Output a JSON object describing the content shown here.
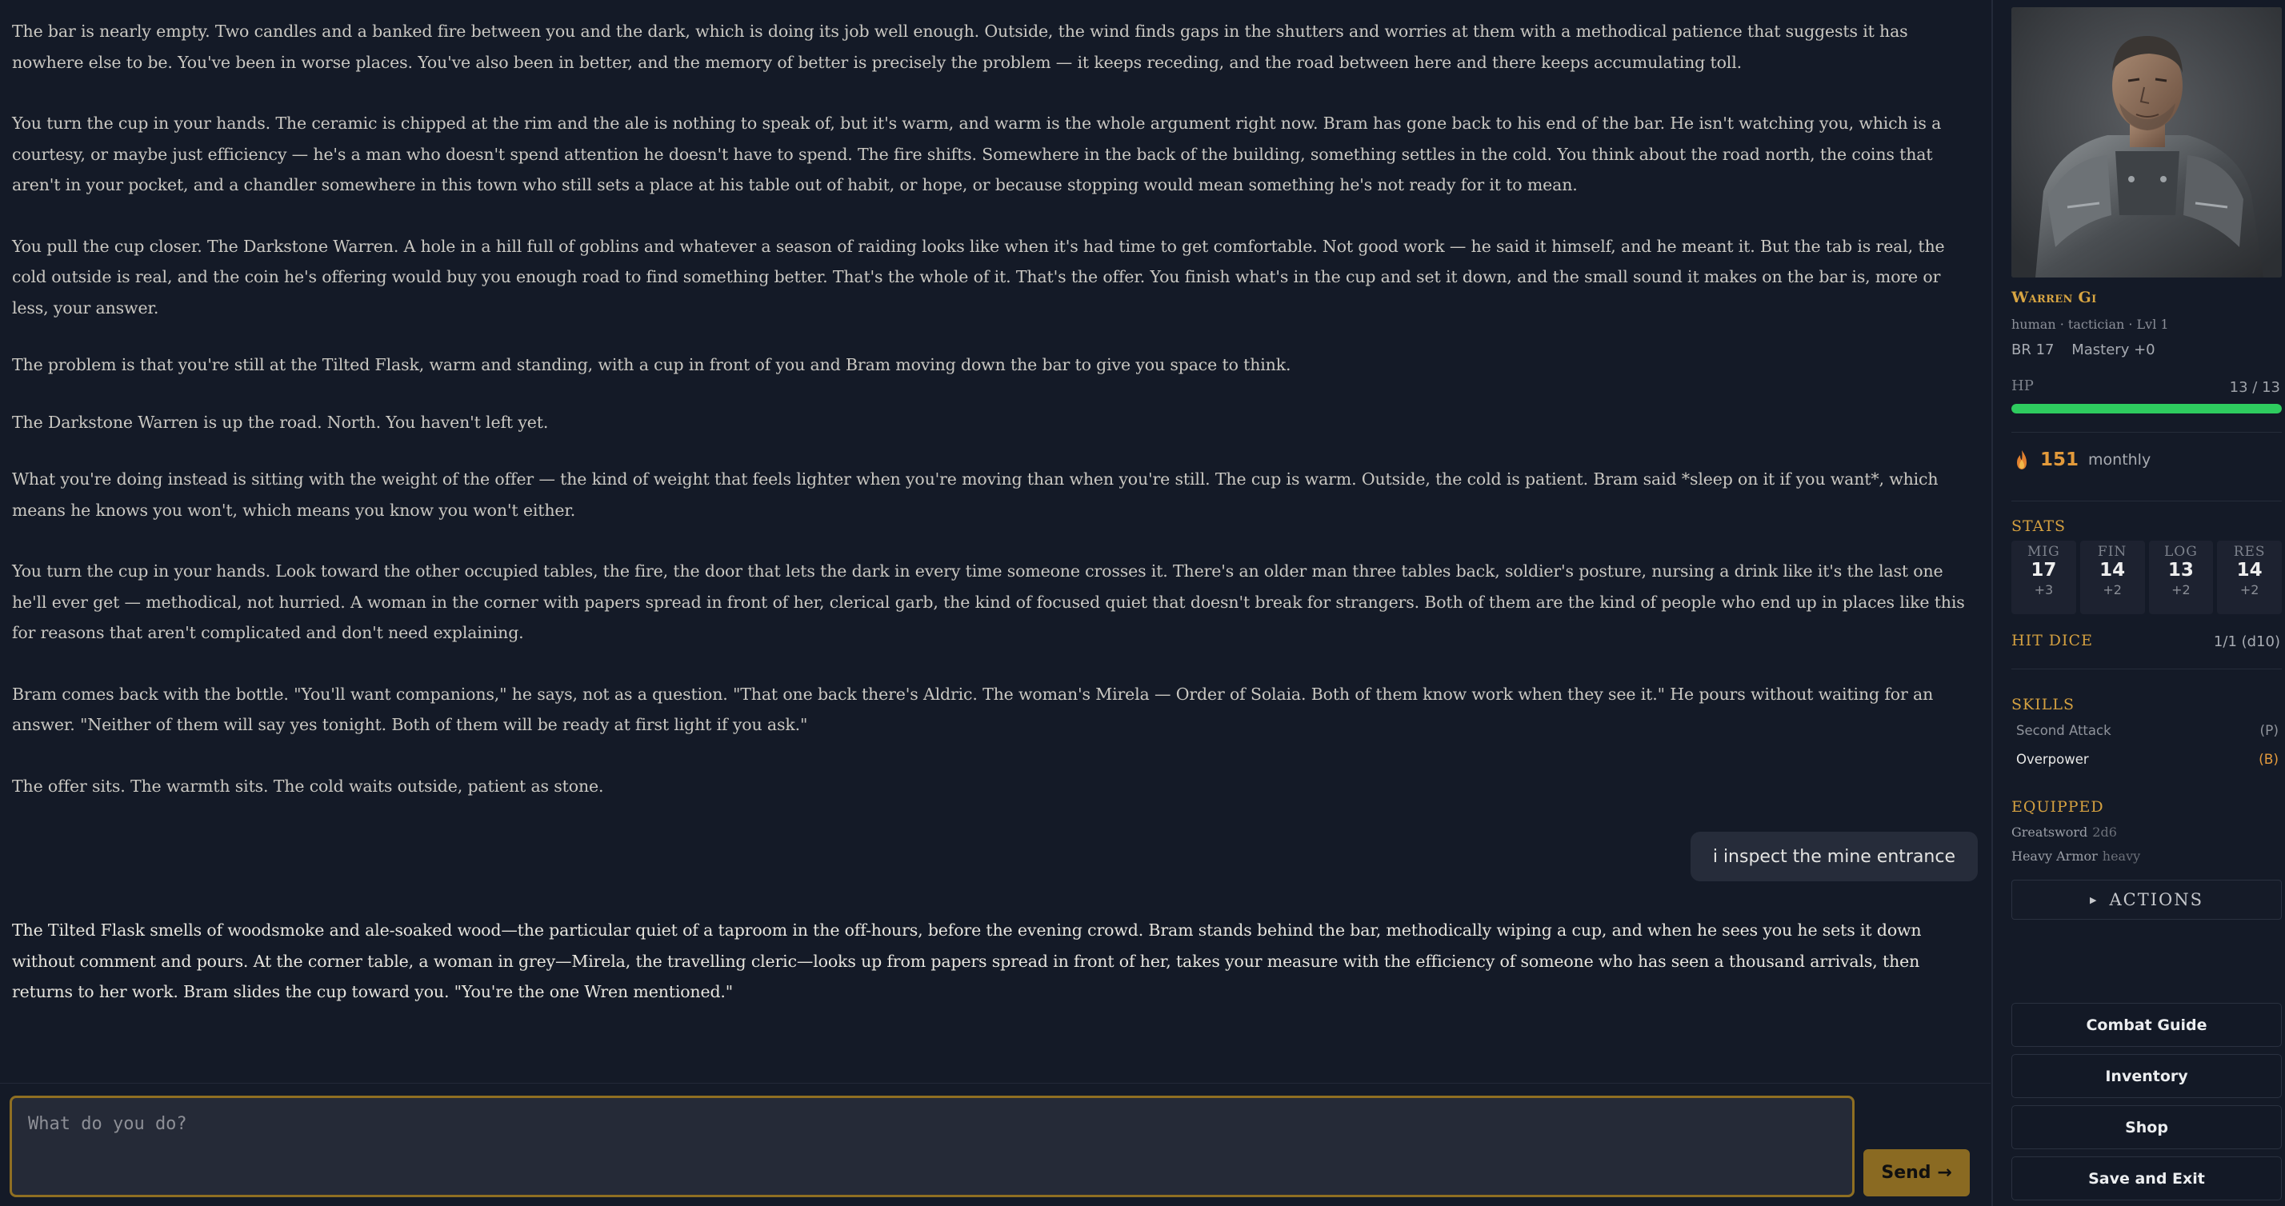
{
  "story": {
    "paragraphs": [
      "The bar is nearly empty. Two candles and a banked fire between you and the dark, which is doing its job well enough. Outside, the wind finds gaps in the shutters and worries at them with a methodical patience that suggests it has nowhere else to be. You've been in worse places. You've also been in better, and the memory of better is precisely the problem — it keeps receding, and the road between here and there keeps accumulating toll.",
      "You turn the cup in your hands. The ceramic is chipped at the rim and the ale is nothing to speak of, but it's warm, and warm is the whole argument right now. Bram has gone back to his end of the bar. He isn't watching you, which is a courtesy, or maybe just efficiency — he's a man who doesn't spend attention he doesn't have to spend. The fire shifts. Somewhere in the back of the building, something settles in the cold. You think about the road north, the coins that aren't in your pocket, and a chandler somewhere in this town who still sets a place at his table out of habit, or hope, or because stopping would mean something he's not ready for it to mean.",
      "You pull the cup closer. The Darkstone Warren. A hole in a hill full of goblins and whatever a season of raiding looks like when it's had time to get comfortable. Not good work — he said it himself, and he meant it. But the tab is real, the cold outside is real, and the coin he's offering would buy you enough road to find something better. That's the whole of it. That's the offer. You finish what's in the cup and set it down, and the small sound it makes on the bar is, more or less, your answer.",
      "The problem is that you're still at the Tilted Flask, warm and standing, with a cup in front of you and Bram moving down the bar to give you space to think.",
      "The Darkstone Warren is up the road. North. You haven't left yet.",
      "What you're doing instead is sitting with the weight of the offer — the kind of weight that feels lighter when you're moving than when you're still. The cup is warm. Outside, the cold is patient. Bram said *sleep on it if you want*, which means he knows you won't, which means you know you won't either.",
      "You turn the cup in your hands. Look toward the other occupied tables, the fire, the door that lets the dark in every time someone crosses it. There's an older man three tables back, soldier's posture, nursing a drink like it's the last one he'll ever get — methodical, not hurried. A woman in the corner with papers spread in front of her, clerical garb, the kind of focused quiet that doesn't break for strangers. Both of them are the kind of people who end up in places like this for reasons that aren't complicated and don't need explaining.",
      "Bram comes back with the bottle. \"You'll want companions,\" he says, not as a question. \"That one back there's Aldric. The woman's Mirela — Order of Solaia. Both of them know work when they see it.\" He pours without waiting for an answer. \"Neither of them will say yes tonight. Both of them will be ready at first light if you ask.\"",
      "The offer sits. The warmth sits. The cold waits outside, patient as stone."
    ],
    "user_message": "i inspect the mine entrance",
    "response": "The Tilted Flask smells of woodsmoke and ale-soaked wood—the particular quiet of a taproom in the off-hours, before the evening crowd. Bram stands behind the bar, methodically wiping a cup, and when he sees you he sets it down without comment and pours. At the corner table, a woman in grey—Mirela, the travelling cleric—looks up from papers spread in front of her, takes your measure with the efficiency of someone who has seen a thousand arrivals, then returns to her work. Bram slides the cup toward you. \"You're the one Wren mentioned.\""
  },
  "input": {
    "placeholder": "What do you do?",
    "send_label": "Send →"
  },
  "character": {
    "name": "Warren Gi",
    "subtitle": "human · tactician · Lvl 1",
    "br": "BR 17",
    "mastery": "Mastery +0",
    "hp_label": "HP",
    "hp_text": "13 / 13",
    "hp_fraction": 1.0,
    "gold_amount": "151",
    "gold_unit": "monthly"
  },
  "stats": {
    "heading": "STATS",
    "items": [
      {
        "name": "MIG",
        "value": "17",
        "mod": "+3"
      },
      {
        "name": "FIN",
        "value": "14",
        "mod": "+2"
      },
      {
        "name": "LOG",
        "value": "13",
        "mod": "+2"
      },
      {
        "name": "RES",
        "value": "14",
        "mod": "+2"
      }
    ]
  },
  "hit_dice": {
    "heading": "HIT DICE",
    "value": "1/1 (d10)"
  },
  "skills": {
    "heading": "SKILLS",
    "items": [
      {
        "name": "Second Attack",
        "tag": "(P)"
      },
      {
        "name": "Overpower",
        "tag": "(B)"
      }
    ]
  },
  "equipped": {
    "heading": "EQUIPPED",
    "items": [
      {
        "name": "Greatsword",
        "detail": "2d6"
      },
      {
        "name": "Heavy Armor",
        "detail": "heavy"
      }
    ]
  },
  "actions_label": "ACTIONS",
  "menu": {
    "combat_guide": "Combat Guide",
    "inventory": "Inventory",
    "shop": "Shop",
    "save_exit": "Save and Exit"
  },
  "colors": {
    "accent_gold": "#d4a040",
    "hp_green": "#2ecc5f",
    "gold_flame": "#e2812f",
    "send_button": "#8a6a22",
    "background": "#141a27"
  }
}
